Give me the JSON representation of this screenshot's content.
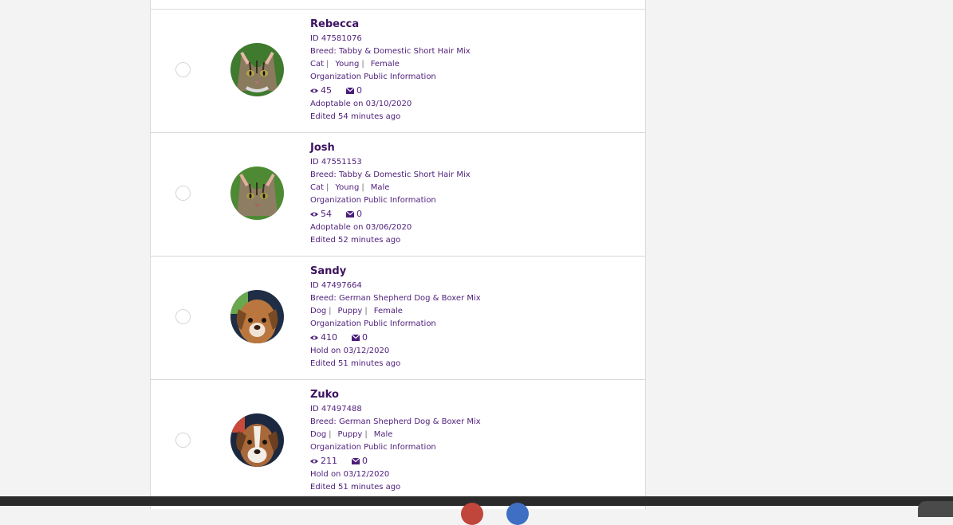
{
  "colors": {
    "accent": "#4d1d7a",
    "name": "#3b1260",
    "border": "#d9d9de"
  },
  "pets": [
    {
      "name": "Rebecca",
      "id": "ID 47581076",
      "breed": "Breed: Tabby & Domestic Short Hair Mix",
      "species": "Cat",
      "age": "Young",
      "sex": "Female",
      "org": "Organization Public Information",
      "views": "45",
      "messages": "0",
      "status": "Adoptable on 03/10/2020",
      "edited": "Edited 54 minutes ago",
      "photo": "tabby-cat"
    },
    {
      "name": "Josh",
      "id": "ID 47551153",
      "breed": "Breed: Tabby & Domestic Short Hair Mix",
      "species": "Cat",
      "age": "Young",
      "sex": "Male",
      "org": "Organization Public Information",
      "views": "54",
      "messages": "0",
      "status": "Adoptable on 03/06/2020",
      "edited": "Edited 52 minutes ago",
      "photo": "tabby-cat"
    },
    {
      "name": "Sandy",
      "id": "ID 47497664",
      "breed": "Breed: German Shepherd Dog & Boxer Mix",
      "species": "Dog",
      "age": "Puppy",
      "sex": "Female",
      "org": "Organization Public Information",
      "views": "410",
      "messages": "0",
      "status": "Hold on 03/12/2020",
      "edited": "Edited 51 minutes ago",
      "photo": "puppy"
    },
    {
      "name": "Zuko",
      "id": "ID 47497488",
      "breed": "Breed: German Shepherd Dog & Boxer Mix",
      "species": "Dog",
      "age": "Puppy",
      "sex": "Male",
      "org": "Organization Public Information",
      "views": "211",
      "messages": "0",
      "status": "Hold on 03/12/2020",
      "edited": "Edited 51 minutes ago",
      "photo": "puppy"
    }
  ]
}
